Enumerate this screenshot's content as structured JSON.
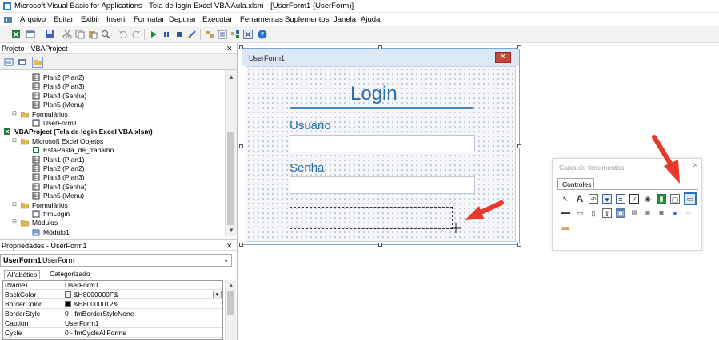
{
  "window": {
    "title": "Microsoft Visual Basic for Applications - Tela de login Excel VBA Aula.xlsm - [UserForm1 (UserForm)]"
  },
  "menu": [
    "Arquivo",
    "Editar",
    "Exibir",
    "Inserir",
    "Formatar",
    "Depurar",
    "Executar",
    "Ferramentas",
    "Suplementos",
    "Janela",
    "Ajuda"
  ],
  "project": {
    "title": "Projeto - VBAProject",
    "tree": [
      "Plan2 (Plan2)",
      "Plan3 (Plan3)",
      "Plan4 (Senha)",
      "Plan5 (Menu)",
      "Formulários",
      "UserForm1",
      "VBAProject (Tela de login Excel VBA.xlsm)",
      "Microsoft Excel Objetos",
      "EstaPasta_de_trabalho",
      "Plan1 (Plan1)",
      "Plan2 (Plan2)",
      "Plan3 (Plan3)",
      "Plan4 (Senha)",
      "Plan5 (Menu)",
      "Formulários",
      "frmLogin",
      "Módulos",
      "Módulo1"
    ]
  },
  "properties": {
    "title": "Propriedades - UserForm1",
    "object_name": "UserForm1",
    "object_type": "UserForm",
    "tabs": [
      "Alfabético",
      "Categorizado"
    ],
    "rows": [
      {
        "name": "(Name)",
        "value": "UserForm1"
      },
      {
        "name": "BackColor",
        "value": "&H8000000F&"
      },
      {
        "name": "BorderColor",
        "value": "&H80000012&"
      },
      {
        "name": "BorderStyle",
        "value": "0 - fmBorderStyleNone"
      },
      {
        "name": "Caption",
        "value": "UserForm1"
      },
      {
        "name": "Cycle",
        "value": "0 - fmCycleAllForms"
      }
    ]
  },
  "form": {
    "caption": "UserForm1",
    "close_glyph": "✕",
    "heading": "Login",
    "user_label": "Usuário",
    "password_label": "Senha"
  },
  "toolbox": {
    "title": "Caixa de ferramentas",
    "tab": "Controles"
  },
  "colors": {
    "accent_text": "#2b6ea3",
    "arrow": "#e8392c",
    "form_close": "#c8463a"
  }
}
